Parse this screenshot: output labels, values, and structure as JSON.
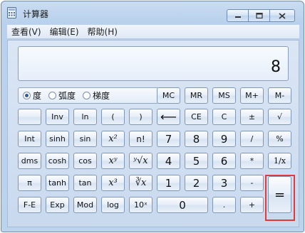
{
  "title": "计算器",
  "menu": [
    "查看(V)",
    "编辑(E)",
    "帮助(H)"
  ],
  "display_value": "8",
  "angle_modes": [
    {
      "label": "度",
      "selected": true
    },
    {
      "label": "弧度",
      "selected": false
    },
    {
      "label": "梯度",
      "selected": false
    }
  ],
  "buttons": {
    "mc": "MC",
    "mr": "MR",
    "ms": "MS",
    "mplus": "M+",
    "mminus": "M-",
    "inv": "Inv",
    "ln": "ln",
    "lparen": "(",
    "rparen": ")",
    "back": "⟵",
    "ce": "CE",
    "c": "C",
    "pm": "±",
    "sqrt": "√",
    "int": "Int",
    "sinh": "sinh",
    "sin": "sin",
    "x2": "x²",
    "fact": "n!",
    "n7": "7",
    "n8": "8",
    "n9": "9",
    "div": "/",
    "pct": "%",
    "dms": "dms",
    "cosh": "cosh",
    "cos": "cos",
    "xy": "xʸ",
    "yrootx": "ʸ√x",
    "n4": "4",
    "n5": "5",
    "n6": "6",
    "mul": "*",
    "recip": "1/x",
    "pi": "π",
    "tanh": "tanh",
    "tan": "tan",
    "x3": "x³",
    "cuberoot": "∛x",
    "n1": "1",
    "n2": "2",
    "n3": "3",
    "sub": "-",
    "fe": "F-E",
    "exp": "Exp",
    "mod": "Mod",
    "log": "log",
    "tenx": "10ˣ",
    "n0": "0",
    "dot": ".",
    "add": "+",
    "eq": "="
  },
  "colors": {
    "highlight": "#e23a3a"
  }
}
